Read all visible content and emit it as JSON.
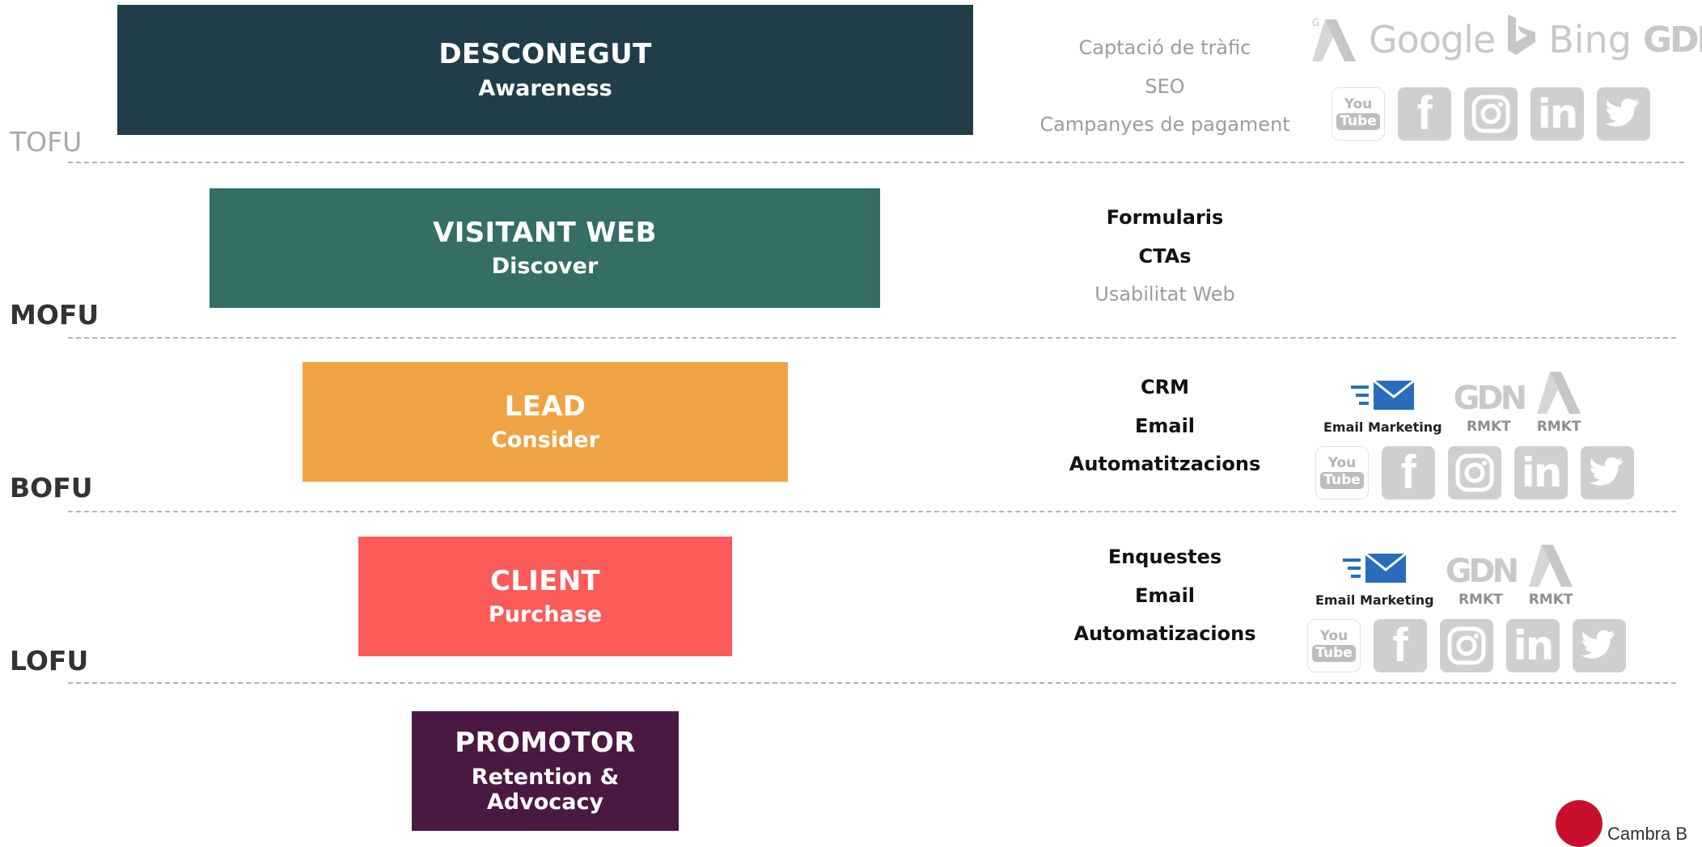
{
  "stages": [
    {
      "title": "DESCONEGUT",
      "subtitle": "Awareness",
      "color": "#223d4a"
    },
    {
      "title": "VISITANT WEB",
      "subtitle": "Discover",
      "color": "#356e66"
    },
    {
      "title": "LEAD",
      "subtitle": "Consider",
      "color": "#f0a343"
    },
    {
      "title": "CLIENT",
      "subtitle": "Purchase",
      "color": "#fd5a5a"
    },
    {
      "title": "PROMOTOR",
      "subtitle": "Retention & Advocacy",
      "color": "#4a1941"
    }
  ],
  "levels": [
    "TOFU",
    "MOFU",
    "BOFU",
    "LOFU"
  ],
  "tactics": {
    "tofu": [
      "Captació de tràfic",
      "SEO",
      "Campanyes de pagament"
    ],
    "mofu": [
      "Formularis",
      "CTAs",
      "Usabilitat Web"
    ],
    "bofu": [
      "CRM",
      "Email",
      "Automatitzacions"
    ],
    "lofu": [
      "Enquestes",
      "Email",
      "Automatizacions"
    ]
  },
  "brands": {
    "google": "Google",
    "bing": "Bing",
    "gdn": "GDN",
    "ads_badge": "G"
  },
  "social": {
    "youtube_you": "You",
    "youtube_tube": "Tube",
    "facebook": "f",
    "linkedin": "in"
  },
  "marketing": {
    "email_caption": "Email Marketing",
    "rmkt": "RMKT"
  },
  "logo_text": "Cambra B",
  "icons": [
    "google-ads-icon",
    "bing-icon",
    "youtube-icon",
    "facebook-icon",
    "instagram-icon",
    "linkedin-icon",
    "twitter-icon",
    "email-icon"
  ]
}
